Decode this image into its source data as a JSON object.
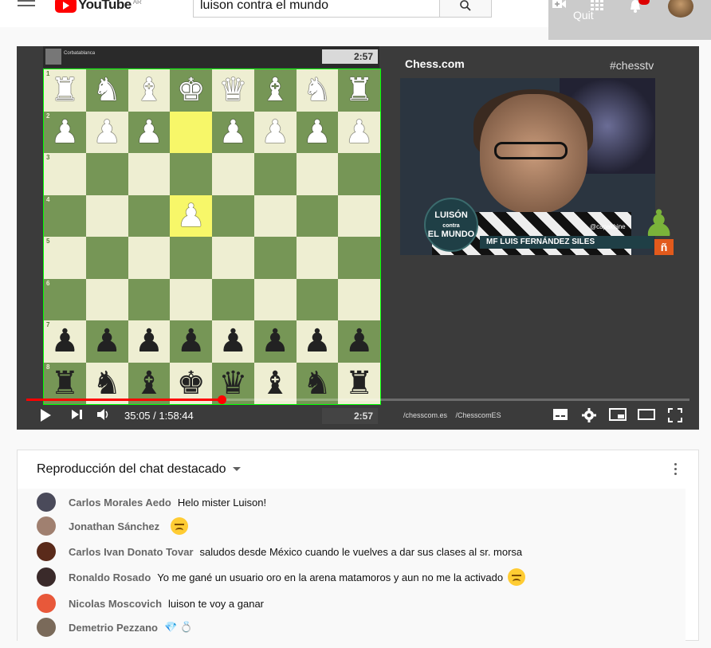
{
  "header": {
    "logo_text": "YouTube",
    "country_code": "AR",
    "search_value": "luison contra el mundo",
    "quit_label": "Quit",
    "notifications_count": ""
  },
  "video": {
    "top_player_name": "Corbatablanca",
    "top_clock": "2:57",
    "bottom_clock": "2:57",
    "brand": "Chess.com",
    "hashtag": "#chesstv",
    "show_logo_line1": "LUISÓN",
    "show_logo_line2": "contra",
    "show_logo_line3": "EL MUNDO",
    "presenter_title": "MF",
    "presenter_name": "LUIS FERNÁNDEZ SILES",
    "twitter_handle": "@capakhine",
    "social_links": [
      "/chesscom.es",
      "/ChesscomES"
    ],
    "current_time": "35:05",
    "duration": "1:58:44",
    "progress_fraction": 0.295,
    "board": {
      "ranks": [
        [
          "♜",
          "♞",
          "♝",
          "♚",
          "♛",
          "♝",
          "♞",
          "♜"
        ],
        [
          "♟",
          "♟",
          "♟",
          "",
          "♟",
          "♟",
          "♟",
          "♟"
        ],
        [
          "",
          "",
          "",
          "",
          "",
          "",
          "",
          ""
        ],
        [
          "",
          "",
          "",
          "♟",
          "",
          "",
          "",
          ""
        ],
        [
          "",
          "",
          "",
          "",
          "",
          "",
          "",
          ""
        ],
        [
          "",
          "",
          "",
          "",
          "",
          "",
          "",
          ""
        ],
        [
          "♟",
          "♟",
          "♟",
          "♟",
          "♟",
          "♟",
          "♟",
          "♟"
        ],
        [
          "♜",
          "♞",
          "♝",
          "♚",
          "♛",
          "♝",
          "♞",
          "♜"
        ]
      ],
      "colors": [
        [
          "w",
          "w",
          "w",
          "w",
          "w",
          "w",
          "w",
          "w"
        ],
        [
          "w",
          "w",
          "w",
          "",
          "w",
          "w",
          "w",
          "w"
        ],
        [
          "",
          "",
          "",
          "",
          "",
          "",
          "",
          ""
        ],
        [
          "",
          "",
          "",
          "w",
          "",
          "",
          "",
          ""
        ],
        [
          "",
          "",
          "",
          "",
          "",
          "",
          "",
          ""
        ],
        [
          "",
          "",
          "",
          "",
          "",
          "",
          "",
          ""
        ],
        [
          "b",
          "b",
          "b",
          "b",
          "b",
          "b",
          "b",
          "b"
        ],
        [
          "b",
          "b",
          "b",
          "b",
          "b",
          "b",
          "b",
          "b"
        ]
      ],
      "rank_labels": [
        "1",
        "2",
        "3",
        "4",
        "5",
        "6",
        "7",
        "8"
      ],
      "highlight": [
        [
          1,
          3
        ],
        [
          3,
          3
        ]
      ]
    }
  },
  "chat": {
    "title": "Reproducción del chat destacado",
    "messages": [
      {
        "author": "Carlos Morales Aedo",
        "text": "Helo mister Luison!",
        "emoji": "",
        "avatar_color": "#4a4a5a"
      },
      {
        "author": "Jonathan Sánchez",
        "text": "",
        "emoji": "sad",
        "avatar_color": "#a08070"
      },
      {
        "author": "Carlos Ivan Donato Tovar",
        "text": "saludos desde México cuando le vuelves a dar sus clases al sr. morsa",
        "emoji": "",
        "avatar_color": "#5a2a1a"
      },
      {
        "author": "Ronaldo Rosado",
        "text": "Yo me gané un usuario oro en la arena matamoros y aun no me la activado",
        "emoji": "sad",
        "avatar_color": "#3a2a2a"
      },
      {
        "author": "Nicolas Moscovich",
        "text": "luison te voy a ganar",
        "emoji": "",
        "avatar_color": "#e8583a"
      },
      {
        "author": "Demetrio Pezzano",
        "text": "💎 💍",
        "emoji": "",
        "avatar_color": "#7a6a5a"
      }
    ]
  }
}
